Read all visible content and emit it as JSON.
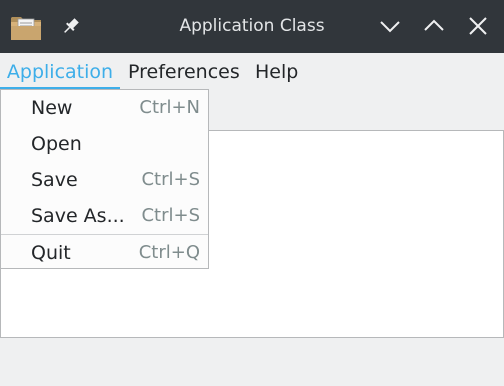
{
  "window": {
    "title": "Application Class"
  },
  "menubar": {
    "items": [
      "Application",
      "Preferences",
      "Help"
    ],
    "active_index": 0
  },
  "dropdown": {
    "items": [
      {
        "label": "New",
        "shortcut": "Ctrl+N"
      },
      {
        "label": "Open",
        "shortcut": ""
      },
      {
        "label": "Save",
        "shortcut": "Ctrl+S"
      },
      {
        "label": "Save As...",
        "shortcut": "Ctrl+S"
      },
      {
        "label": "Quit",
        "shortcut": "Ctrl+Q"
      }
    ]
  },
  "icons": {
    "app": "folder-document-icon",
    "pin": "pin-icon",
    "minimize": "chevron-down-icon",
    "maximize": "chevron-up-icon",
    "close": "close-icon"
  },
  "colors": {
    "titlebar": "#31363b",
    "accent": "#3daee9",
    "menu_text": "#232629",
    "shortcut_text": "#7f8c8d"
  }
}
